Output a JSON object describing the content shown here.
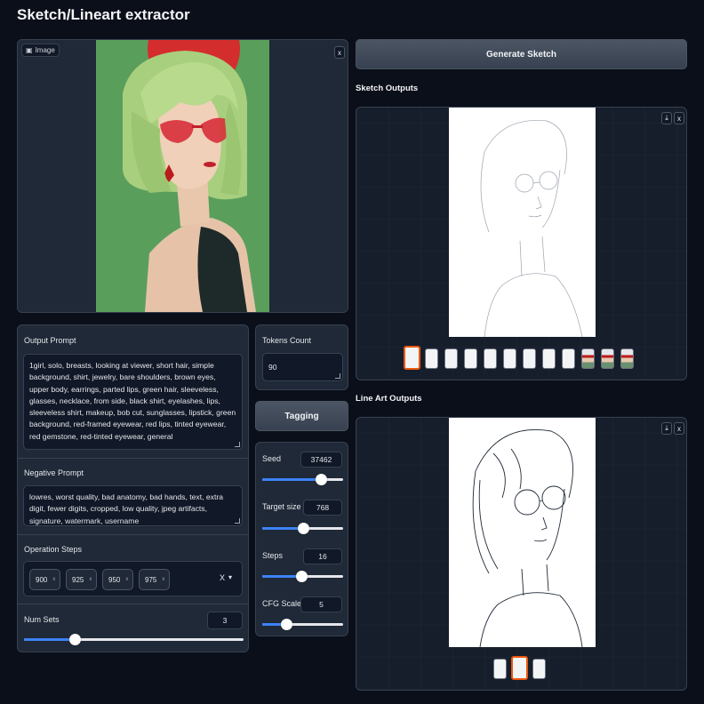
{
  "app": {
    "title": "Sketch/Lineart extractor"
  },
  "image_input": {
    "label": "Image",
    "close": "x"
  },
  "output_prompt": {
    "label": "Output Prompt",
    "value": "1girl, solo, breasts, looking at viewer, short hair, simple background, shirt, jewelry, bare shoulders, brown eyes, upper body, earrings, parted lips, green hair, sleeveless, glasses, necklace, from side, black shirt, eyelashes, lips, sleeveless shirt, makeup, bob cut, sunglasses, lipstick, green background, red-framed eyewear, red lips, tinted eyewear, red gemstone, red-tinted eyewear, general"
  },
  "negative_prompt": {
    "label": "Negative Prompt",
    "value": "lowres, worst quality, bad anatomy, bad hands, text, extra digit, fewer digits, cropped, low quality, jpeg artifacts, signature, watermark, username"
  },
  "operation_steps": {
    "label": "Operation Steps",
    "chips": [
      "900",
      "925",
      "950",
      "975"
    ],
    "chip_remove": "x",
    "clear": "X",
    "dropdown": "▾"
  },
  "num_sets": {
    "label": "Num Sets",
    "value": "3",
    "fraction": 0.23
  },
  "tokens": {
    "label": "Tokens Count",
    "value": "90"
  },
  "tagging_button": "Tagging",
  "seed": {
    "label": "Seed",
    "value": "37462",
    "fraction": 0.72
  },
  "target_size": {
    "label": "Target size",
    "value": "768",
    "fraction": 0.5
  },
  "steps": {
    "label": "Steps",
    "value": "16",
    "fraction": 0.48
  },
  "cfg_scale": {
    "label": "CFG Scale",
    "value": "5",
    "fraction": 0.3
  },
  "generate_button": "Generate Sketch",
  "sketch_outputs": {
    "label": "Sketch Outputs",
    "download": "⤓",
    "close": "x",
    "thumb_count": 12,
    "selected": 0
  },
  "lineart_outputs": {
    "label": "Line Art Outputs",
    "download": "⤓",
    "close": "x",
    "thumb_count": 3,
    "selected": 1
  },
  "colors": {
    "accent": "#3b82f6",
    "selection": "#ea580c",
    "panel": "#1f2937",
    "background": "#0b0f19"
  }
}
